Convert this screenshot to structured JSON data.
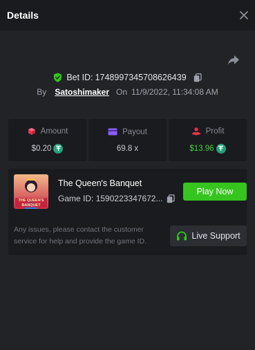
{
  "header": {
    "title": "Details",
    "close_icon": "close-icon"
  },
  "bet": {
    "bet_id_label": "Bet ID:",
    "bet_id": "1748997345708626439",
    "by_label": "By",
    "username": "Satoshimaker",
    "on_label": "On",
    "datetime": "11/9/2022, 11:34:08 AM"
  },
  "stats": {
    "amount": {
      "label": "Amount",
      "value": "$0.20",
      "icon": "dice-icon",
      "color": "#ff4d6d"
    },
    "payout": {
      "label": "Payout",
      "value": "69.8 x",
      "icon": "card-icon",
      "color": "#8a5cf6"
    },
    "profit": {
      "label": "Profit",
      "value": "$13.96",
      "icon": "profit-icon",
      "color": "#e8334a",
      "value_color": "#3fd43f"
    }
  },
  "game": {
    "name": "The Queen's Banquet",
    "game_id_label": "Game ID:",
    "game_id": "1590223347672...",
    "thumb_text": "THE QUEEN'S BANQUET",
    "play_label": "Play Now",
    "help_text": "Any issues, please contact the customer service for help and provide the game ID.",
    "support_label": "Live Support"
  },
  "colors": {
    "background": "#222327",
    "panel": "#1a1b1e",
    "accent_green": "#36c51f",
    "coin_teal": "#26a17b"
  }
}
